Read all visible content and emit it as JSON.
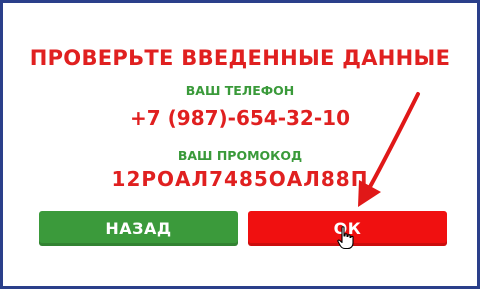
{
  "dialog": {
    "title": "ПРОВЕРЬТЕ ВВЕДЕННЫЕ ДАННЫЕ",
    "phone_label": "ВАШ ТЕЛЕФОН",
    "phone_value": "+7 (987)-654-32-10",
    "promo_label": "ВАШ ПРОМОКОД",
    "promo_value": "12РОАЛ7485ОАЛ88П"
  },
  "buttons": {
    "back_label": "НАЗАД",
    "ok_label": "ОК"
  },
  "colors": {
    "accent_red": "#e02020",
    "label_green": "#3a9a3a",
    "back_button": "#3b9a3b",
    "ok_button": "#f01010",
    "frame_border": "#2a3f8a"
  },
  "icons": [
    "arrow-annotation-icon",
    "hand-cursor-icon"
  ]
}
